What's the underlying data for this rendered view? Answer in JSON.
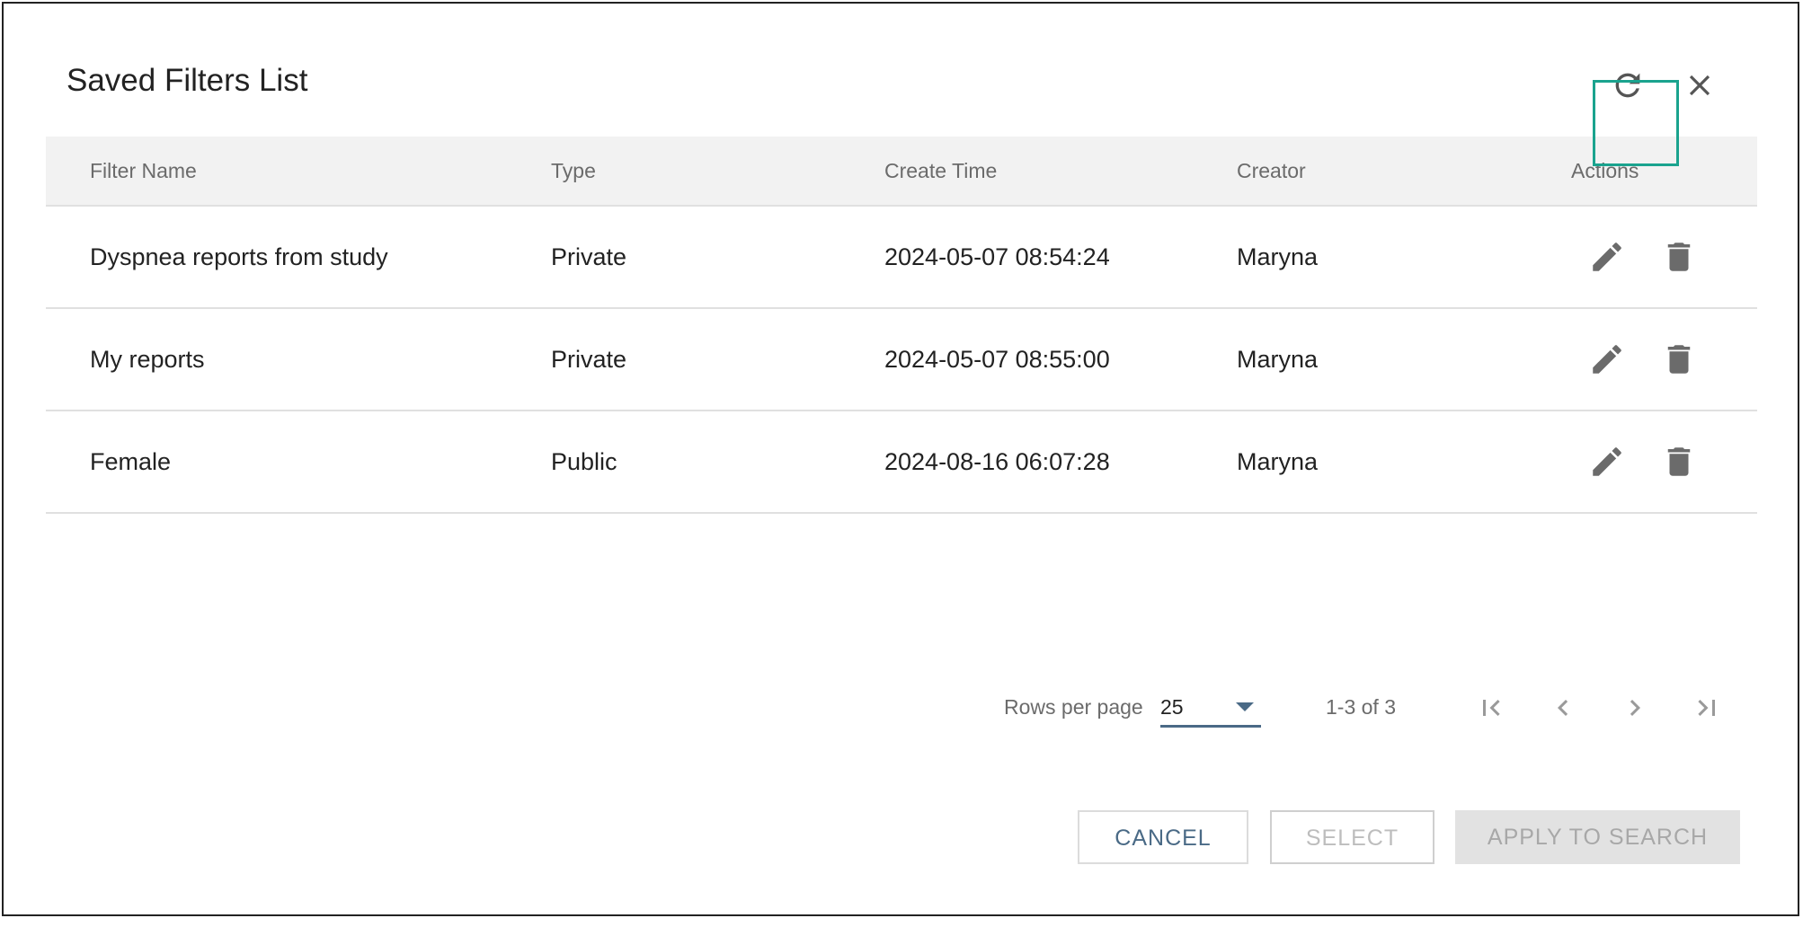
{
  "dialog": {
    "title": "Saved Filters List"
  },
  "table": {
    "headers": {
      "filter_name": "Filter Name",
      "type": "Type",
      "create_time": "Create Time",
      "creator": "Creator",
      "actions": "Actions"
    },
    "rows": [
      {
        "filter_name": "Dyspnea reports from study",
        "type": "Private",
        "create_time": "2024-05-07 08:54:24",
        "creator": "Maryna"
      },
      {
        "filter_name": "My reports",
        "type": "Private",
        "create_time": "2024-05-07 08:55:00",
        "creator": "Maryna"
      },
      {
        "filter_name": "Female",
        "type": "Public",
        "create_time": "2024-08-16 06:07:28",
        "creator": "Maryna"
      }
    ]
  },
  "pagination": {
    "rows_per_page_label": "Rows per page",
    "rows_per_page_value": "25",
    "range": "1-3 of 3"
  },
  "footer": {
    "cancel_label": "CANCEL",
    "select_label": "SELECT",
    "apply_label": "APPLY TO SEARCH"
  },
  "colors": {
    "accent": "#4a6a86",
    "highlight": "#1aa38e",
    "icon": "#6b6b6b",
    "header_bg": "#f2f2f2"
  }
}
